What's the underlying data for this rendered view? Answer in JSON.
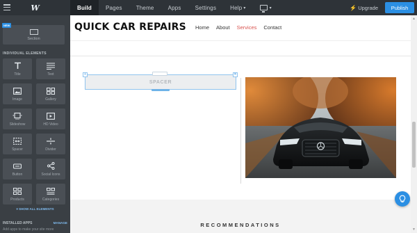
{
  "topbar": {
    "logo": "W",
    "tabs": [
      {
        "label": "Build"
      },
      {
        "label": "Pages"
      },
      {
        "label": "Theme"
      },
      {
        "label": "Apps"
      },
      {
        "label": "Settings"
      },
      {
        "label": "Help"
      }
    ],
    "upgrade_label": "Upgrade",
    "publish_label": "Publish"
  },
  "sidebar": {
    "new_badge": "NEW",
    "section_label": "Section",
    "heading": "INDIVIDUAL ELEMENTS",
    "elements": [
      {
        "label": "Title",
        "icon": "title-icon"
      },
      {
        "label": "Text",
        "icon": "text-icon"
      },
      {
        "label": "Image",
        "icon": "image-icon"
      },
      {
        "label": "Gallery",
        "icon": "gallery-icon"
      },
      {
        "label": "Slideshow",
        "icon": "slideshow-icon"
      },
      {
        "label": "HD Video",
        "icon": "video-icon"
      },
      {
        "label": "Spacer",
        "icon": "spacer-icon"
      },
      {
        "label": "Divider",
        "icon": "divider-icon"
      },
      {
        "label": "Button",
        "icon": "button-icon"
      },
      {
        "label": "Social Icons",
        "icon": "share-icon"
      },
      {
        "label": "Products",
        "icon": "products-icon"
      },
      {
        "label": "Categories",
        "icon": "categories-icon"
      }
    ],
    "show_all": "SHOW ALL ELEMENTS",
    "installed_heading": "INSTALLED APPS",
    "manage_label": "MANAGE",
    "add_apps_text": "Add apps to make your site more"
  },
  "site": {
    "brand": "QUICK CAR REPAIRS",
    "nav": [
      {
        "label": "Home",
        "active": false
      },
      {
        "label": "About",
        "active": false
      },
      {
        "label": "Services",
        "active": true
      },
      {
        "label": "Contact",
        "active": false
      }
    ],
    "spacer_label": "SPACER",
    "section_heading": "RECOMMENDATIONS"
  },
  "colors": {
    "accent": "#2b8fe3",
    "active_nav": "#d9534f",
    "topbar": "#2e3338",
    "sidebar": "#3a3f44"
  }
}
